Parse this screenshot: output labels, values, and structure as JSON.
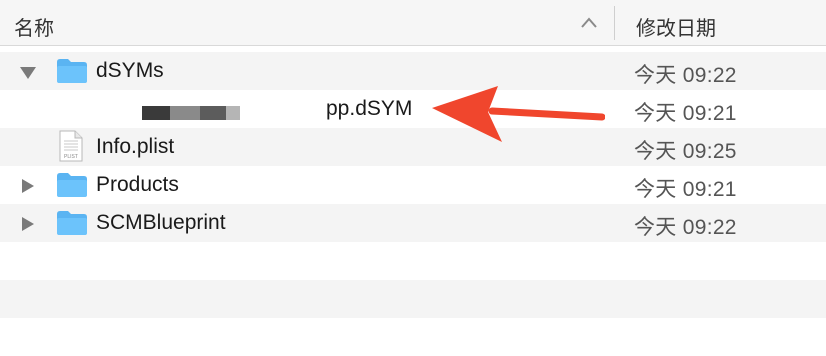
{
  "header": {
    "name_label": "名称",
    "date_label": "修改日期"
  },
  "rows": [
    {
      "name": "dSYMs",
      "date": "今天 09:22",
      "kind": "folder",
      "disclosure": "expanded"
    },
    {
      "name": "pp.dSYM",
      "date": "今天 09:21",
      "kind": "file",
      "note": "name partially redacted"
    },
    {
      "name": "Info.plist",
      "date": "今天 09:25",
      "kind": "plist"
    },
    {
      "name": "Products",
      "date": "今天 09:21",
      "kind": "folder",
      "disclosure": "collapsed"
    },
    {
      "name": "SCMBlueprint",
      "date": "今天 09:22",
      "kind": "folder",
      "disclosure": "collapsed"
    }
  ],
  "plist_badge": "PLIST",
  "colors": {
    "folder_blue": "#5ab4f2",
    "arrow_red": "#f0462d",
    "header_bg": "#f6f6f6",
    "stripe_bg": "#f4f4f4"
  }
}
